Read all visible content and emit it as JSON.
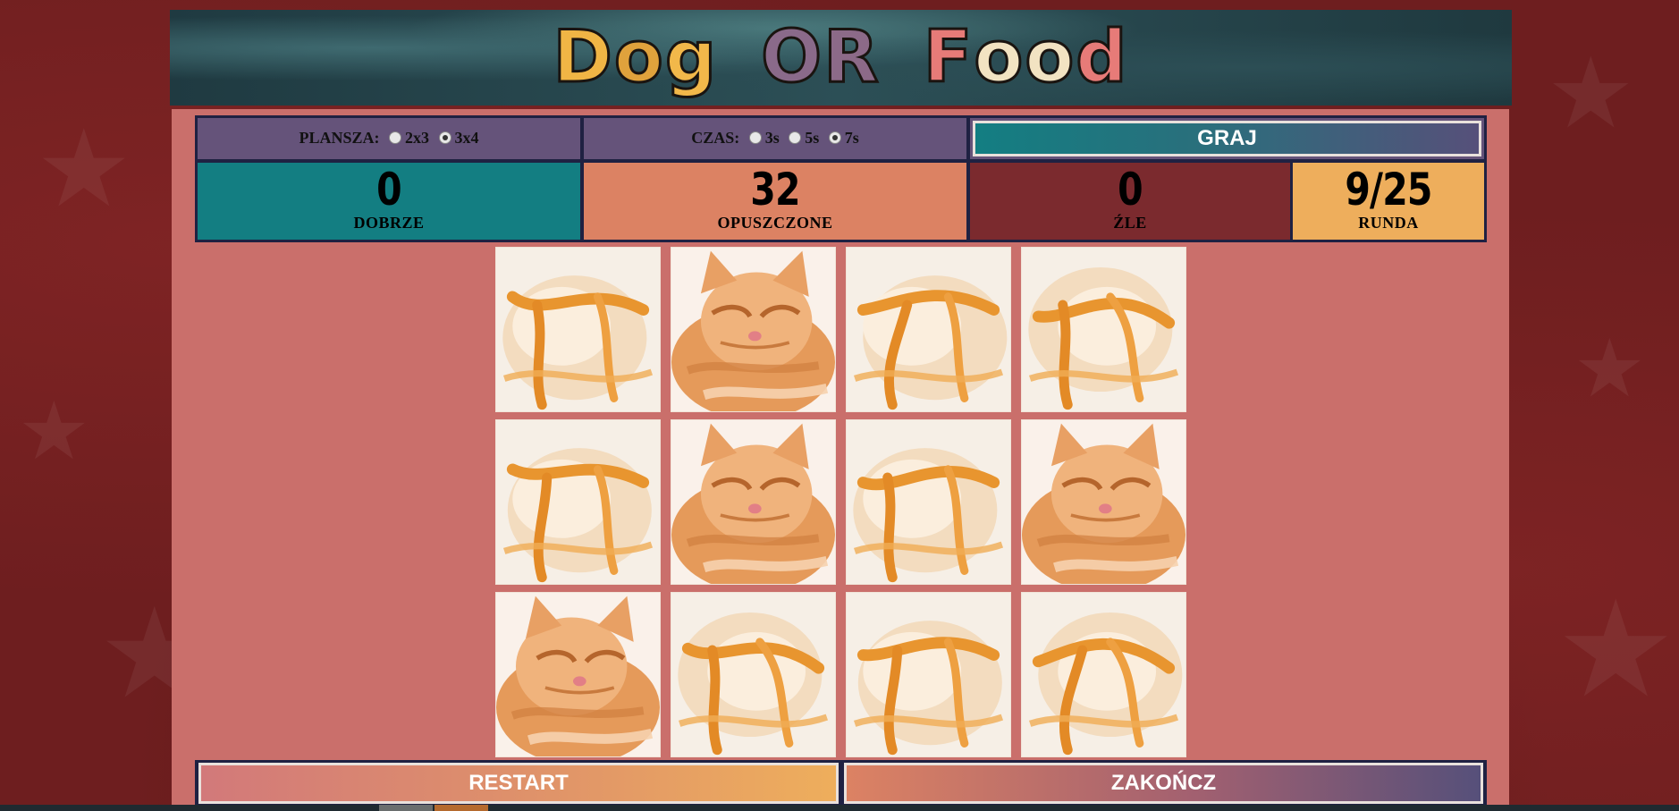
{
  "header": {
    "logo_text": "Dog OR Food",
    "logo_letters": [
      "D",
      "o",
      "g",
      "O",
      "R",
      "F",
      "o",
      "o",
      "d"
    ]
  },
  "controls": {
    "board": {
      "label": "PLANSZA:",
      "options": [
        "2x3",
        "3x4"
      ],
      "selected": "3x4"
    },
    "time": {
      "label": "CZAS:",
      "options": [
        "3s",
        "5s",
        "7s"
      ],
      "selected": "7s"
    },
    "play_label": "GRAJ"
  },
  "stats": {
    "correct": {
      "value": "0",
      "label": "DOBRZE"
    },
    "missed": {
      "value": "32",
      "label": "OPUSZCZONE"
    },
    "wrong": {
      "value": "0",
      "label": "ŹLE"
    },
    "round": {
      "value": "9/25",
      "label": "RUNDA"
    }
  },
  "grid": {
    "rows": 3,
    "cols": 4,
    "tiles": [
      "ice-cream",
      "kitten",
      "ice-cream",
      "ice-cream",
      "ice-cream",
      "kitten",
      "ice-cream",
      "kitten",
      "kitten",
      "ice-cream",
      "ice-cream",
      "ice-cream"
    ]
  },
  "actions": {
    "restart_label": "RESTART",
    "end_label": "ZAKOŃCZ"
  },
  "colors": {
    "teal": "#137e82",
    "orange": "#dc8263",
    "maroon": "#7b2a2e",
    "gold": "#eeae5c",
    "purple": "#65537a",
    "panel": "#ca6f6b"
  }
}
